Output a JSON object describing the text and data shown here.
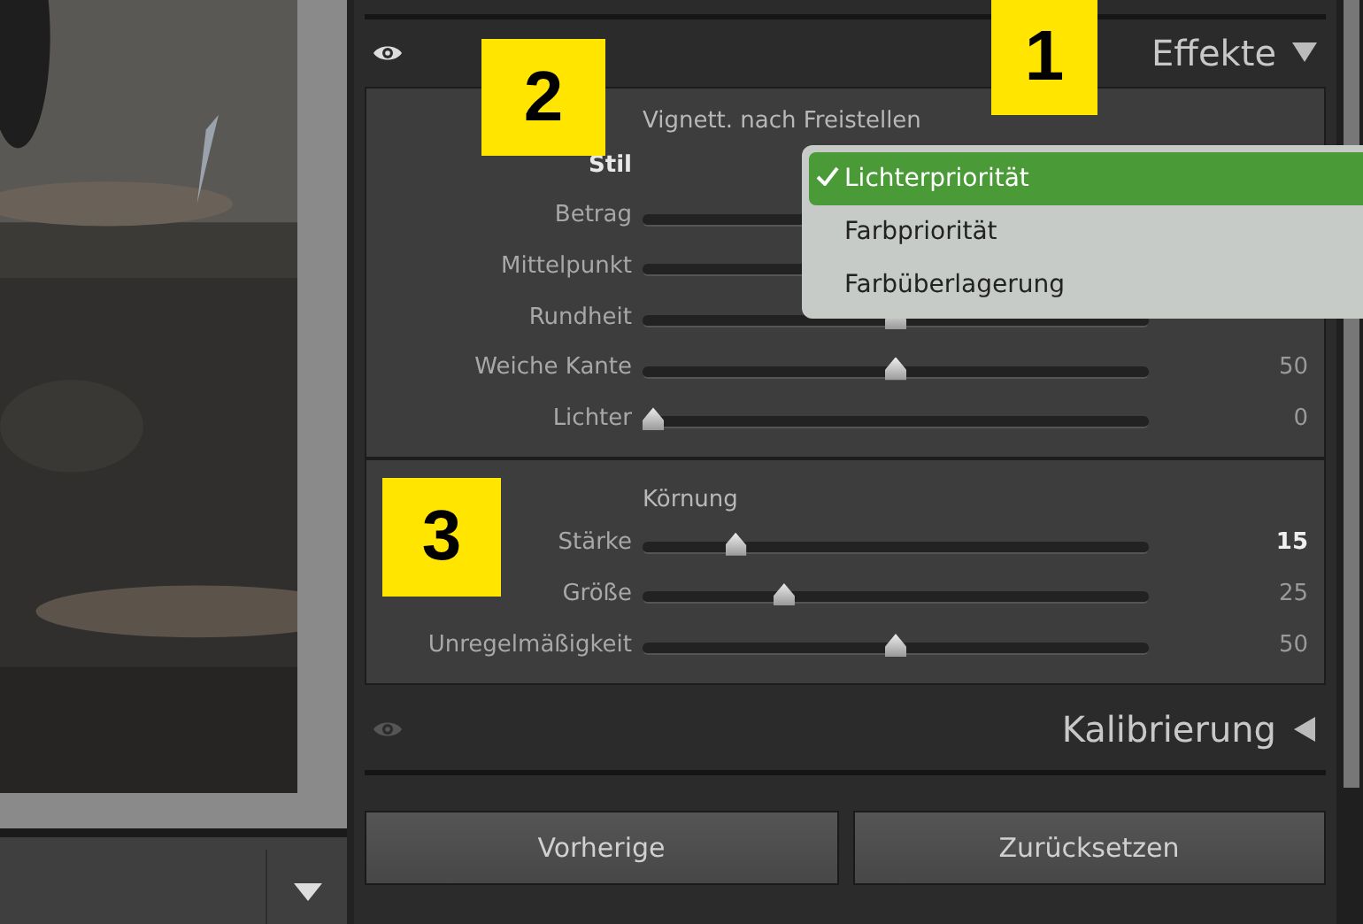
{
  "effects_panel": {
    "title": "Effekte",
    "expanded": true,
    "vignette": {
      "title": "Vignett. nach Freistellen",
      "rows": [
        {
          "kind": "label",
          "label": "Stil"
        },
        {
          "kind": "slider",
          "label": "Betrag"
        },
        {
          "kind": "slider",
          "label": "Mittelpunkt"
        },
        {
          "kind": "slider",
          "label": "Rundheit",
          "level": 0.5
        },
        {
          "kind": "slider",
          "label": "Weiche Kante",
          "level": 0.5,
          "value": "50"
        },
        {
          "kind": "slider",
          "label": "Lichter",
          "level": 0,
          "value": "0"
        }
      ]
    },
    "grain": {
      "title": "Körnung",
      "rows": [
        {
          "kind": "slider",
          "label": "Stärke",
          "level": 0.17,
          "value": "15",
          "active": true
        },
        {
          "kind": "slider",
          "label": "Größe",
          "level": 0.27,
          "value": "25",
          "active": false
        },
        {
          "kind": "slider",
          "label": "Unregelmäßigkeit",
          "level": 0.5,
          "value": "50",
          "active": false
        }
      ]
    }
  },
  "style_menu": [
    {
      "label": "Lichterpriorität",
      "selected": true
    },
    {
      "label": "Farbpriorität",
      "selected": false
    },
    {
      "label": "Farbüberlagerung",
      "selected": false
    }
  ],
  "calibration_panel": {
    "title": "Kalibrierung",
    "expanded": false
  },
  "buttons": [
    "Vorherige",
    "Zurücksetzen"
  ],
  "callouts": [
    "1",
    "2",
    "3"
  ]
}
